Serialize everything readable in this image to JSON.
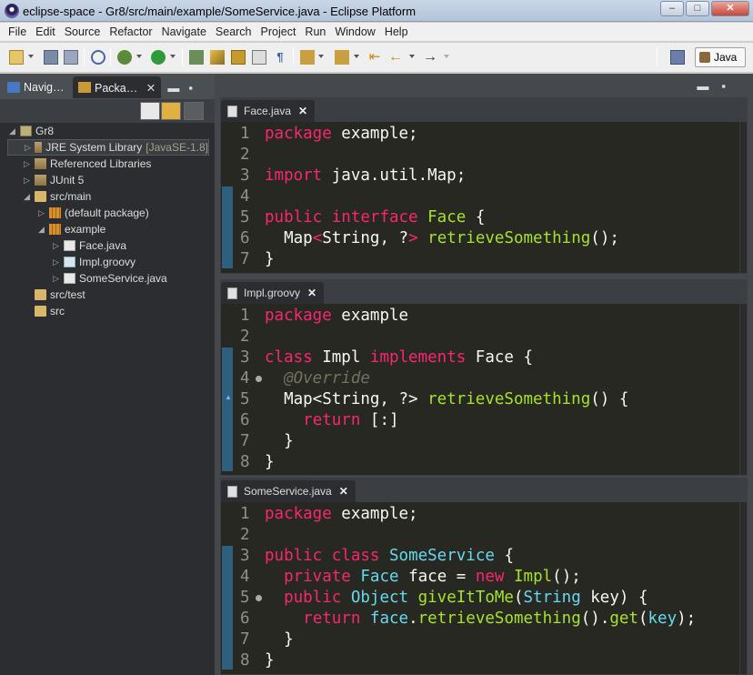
{
  "window": {
    "title": "eclipse-space - Gr8/src/main/example/SomeService.java - Eclipse Platform",
    "controls": [
      "–",
      "□",
      "✕"
    ]
  },
  "menu": [
    "File",
    "Edit",
    "Source",
    "Refactor",
    "Navigate",
    "Search",
    "Project",
    "Run",
    "Window",
    "Help"
  ],
  "perspective": {
    "label": "Java"
  },
  "left_tabs": [
    {
      "label": "Navig…"
    },
    {
      "label": "Packa…",
      "close": "✕"
    }
  ],
  "tree": [
    {
      "label": "Gr8",
      "sub": "",
      "icon": "project-icon",
      "level": 0,
      "twisty": "◢"
    },
    {
      "label": "JRE System Library",
      "sub": "[JavaSE-1.8]",
      "icon": "library-icon",
      "level": 1,
      "twisty": "▷"
    },
    {
      "label": "Referenced Libraries",
      "sub": "",
      "icon": "library-icon",
      "level": 1,
      "twisty": "▷"
    },
    {
      "label": "JUnit 5",
      "sub": "",
      "icon": "library-icon",
      "level": 1,
      "twisty": "▷"
    },
    {
      "label": "src/main",
      "sub": "",
      "icon": "source-folder-icon",
      "level": 1,
      "twisty": "◢"
    },
    {
      "label": "(default package)",
      "sub": "",
      "icon": "package-icon",
      "level": 2,
      "twisty": "▷"
    },
    {
      "label": "example",
      "sub": "",
      "icon": "package-icon",
      "level": 2,
      "twisty": "◢"
    },
    {
      "label": "Face.java",
      "sub": "",
      "icon": "java-file-icon",
      "level": 3,
      "twisty": "▷"
    },
    {
      "label": "Impl.groovy",
      "sub": "",
      "icon": "groovy-file-icon",
      "level": 3,
      "twisty": "▷"
    },
    {
      "label": "SomeService.java",
      "sub": "",
      "icon": "java-file-icon",
      "level": 3,
      "twisty": "▷"
    },
    {
      "label": "src/test",
      "sub": "",
      "icon": "source-folder-icon",
      "level": 1,
      "twisty": ""
    },
    {
      "label": "src",
      "sub": "",
      "icon": "folder-icon",
      "level": 1,
      "twisty": ""
    }
  ],
  "editors": [
    {
      "tab": "Face.java",
      "close": "✕",
      "lines": [
        {
          "n": "1",
          "html": "<span class='k'>package</span> example;"
        },
        {
          "n": "2",
          "html": ""
        },
        {
          "n": "3",
          "html": "<span class='k'>import</span> java.util.Map;"
        },
        {
          "n": "4",
          "html": ""
        },
        {
          "n": "5",
          "html": "<span class='k'>public</span> <span class='k'>interface</span> <span class='cls'>Face</span> {"
        },
        {
          "n": "6",
          "html": "  Map<span class='k'>&lt;</span>String, ?<span class='k'>&gt;</span> <span class='f'>retrieveSomething</span>();"
        },
        {
          "n": "7",
          "html": "}"
        }
      ]
    },
    {
      "tab": "Impl.groovy",
      "close": "✕",
      "lines": [
        {
          "n": "1",
          "html": "<span class='k'>package</span> example"
        },
        {
          "n": "2",
          "html": ""
        },
        {
          "n": "3",
          "html": "<span class='k'>class</span> Impl <span class='k'>implements</span> Face {"
        },
        {
          "n": "4",
          "html": "  <span class='an'>@Override</span>"
        },
        {
          "n": "5",
          "html": "  Map&lt;String, ?&gt; <span class='f'>retrieveSomething</span>() {"
        },
        {
          "n": "6",
          "html": "    <span class='k'>return</span> [:]"
        },
        {
          "n": "7",
          "html": "  }"
        },
        {
          "n": "8",
          "html": "}"
        }
      ]
    },
    {
      "tab": "SomeService.java",
      "close": "✕",
      "lines": [
        {
          "n": "1",
          "html": "<span class='k'>package</span> example;"
        },
        {
          "n": "2",
          "html": ""
        },
        {
          "n": "3",
          "html": "<span class='k'>public</span> <span class='k'>class</span> <span class='ty'>SomeService</span> {"
        },
        {
          "n": "4",
          "html": "  <span class='k'>private</span> <span class='ty'>Face</span> face = <span class='k'>new</span> <span class='f'>Impl</span>();"
        },
        {
          "n": "5",
          "html": "  <span class='k'>public</span> <span class='ty'>Object</span> <span class='f'>giveItToMe</span>(<span class='ty'>String</span> key) {"
        },
        {
          "n": "6",
          "html": "    <span class='k'>return</span> <span class='ty'>face</span>.<span class='f'>retrieveSomething</span>().<span class='f'>get</span>(<span class='ty'>key</span>);"
        },
        {
          "n": "7",
          "html": "  }"
        },
        {
          "n": "8",
          "html": "}"
        }
      ]
    }
  ]
}
